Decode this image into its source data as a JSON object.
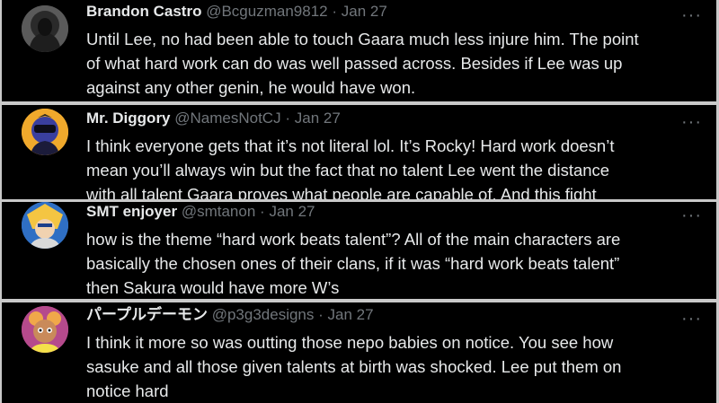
{
  "tweets": [
    {
      "name": "Brandon Castro",
      "handle": "@Bcguzman9812",
      "sep": "·",
      "date": "Jan 27",
      "more": "···",
      "lines": [
        "Until Lee, no had been able to touch Gaara much less injure him. The point",
        "of what hard work can do was well passed across. Besides if Lee was up",
        "against any other genin, he would have won."
      ]
    },
    {
      "name": "Mr. Diggory",
      "handle": "@NamesNotCJ",
      "sep": "·",
      "date": "Jan 27",
      "more": "···",
      "lines": [
        "I think everyone gets that it’s not literal lol. It’s Rocky! Hard work doesn’t",
        "mean you’ll always win but the fact that no talent Lee went the distance",
        "with all talent Gaara proves what people are capable of. And this fight"
      ]
    },
    {
      "name": "SMT enjoyer",
      "handle": "@smtanon",
      "sep": "·",
      "date": "Jan 27",
      "more": "···",
      "lines": [
        "how is the theme “hard work beats talent”? All of the main characters are",
        "basically the chosen ones of their clans, if it was “hard work beats talent”",
        "then Sakura would have more W’s"
      ]
    },
    {
      "name": "パープルデーモン",
      "handle": "@p3g3designs",
      "sep": "·",
      "date": "Jan 27",
      "more": "···",
      "lines": [
        "I think it more so was outting those nepo babies on notice. You see how",
        "sasuke and all those given talents at birth was shocked. Lee put them on",
        "notice hard"
      ]
    }
  ]
}
